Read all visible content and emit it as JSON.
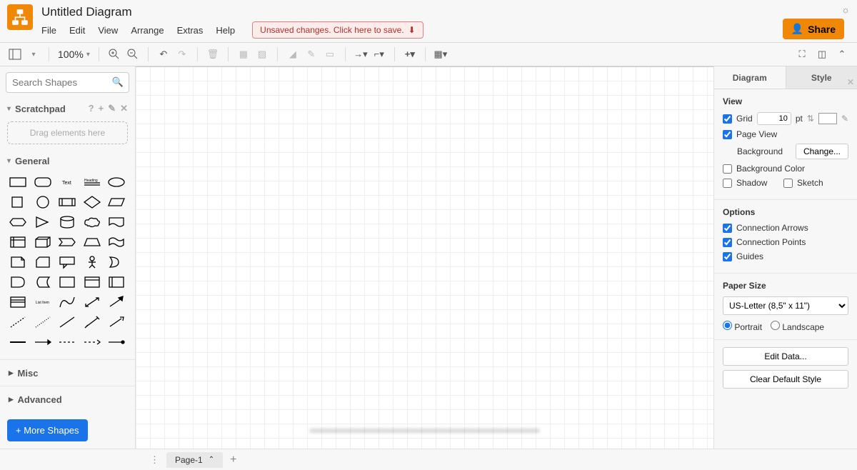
{
  "header": {
    "title": "Untitled Diagram",
    "menus": [
      "File",
      "Edit",
      "View",
      "Arrange",
      "Extras",
      "Help"
    ],
    "unsaved_label": "Unsaved changes. Click here to save.",
    "share_label": "Share"
  },
  "toolbar": {
    "zoom": "100%"
  },
  "sidebar": {
    "search_placeholder": "Search Shapes",
    "scratchpad_label": "Scratchpad",
    "scratchpad_drop": "Drag elements here",
    "general_label": "General",
    "misc_label": "Misc",
    "advanced_label": "Advanced",
    "more_shapes_label": "+ More Shapes"
  },
  "right_panel": {
    "tab_diagram": "Diagram",
    "tab_style": "Style",
    "view_section": "View",
    "grid_label": "Grid",
    "grid_value": "10",
    "grid_unit": "pt",
    "page_view_label": "Page View",
    "background_label": "Background",
    "change_label": "Change...",
    "bg_color_label": "Background Color",
    "shadow_label": "Shadow",
    "sketch_label": "Sketch",
    "options_section": "Options",
    "conn_arrows_label": "Connection Arrows",
    "conn_points_label": "Connection Points",
    "guides_label": "Guides",
    "paper_section": "Paper Size",
    "paper_value": "US-Letter (8,5\" x 11\")",
    "portrait_label": "Portrait",
    "landscape_label": "Landscape",
    "edit_data_label": "Edit Data...",
    "clear_style_label": "Clear Default Style"
  },
  "footer": {
    "page_label": "Page-1"
  }
}
